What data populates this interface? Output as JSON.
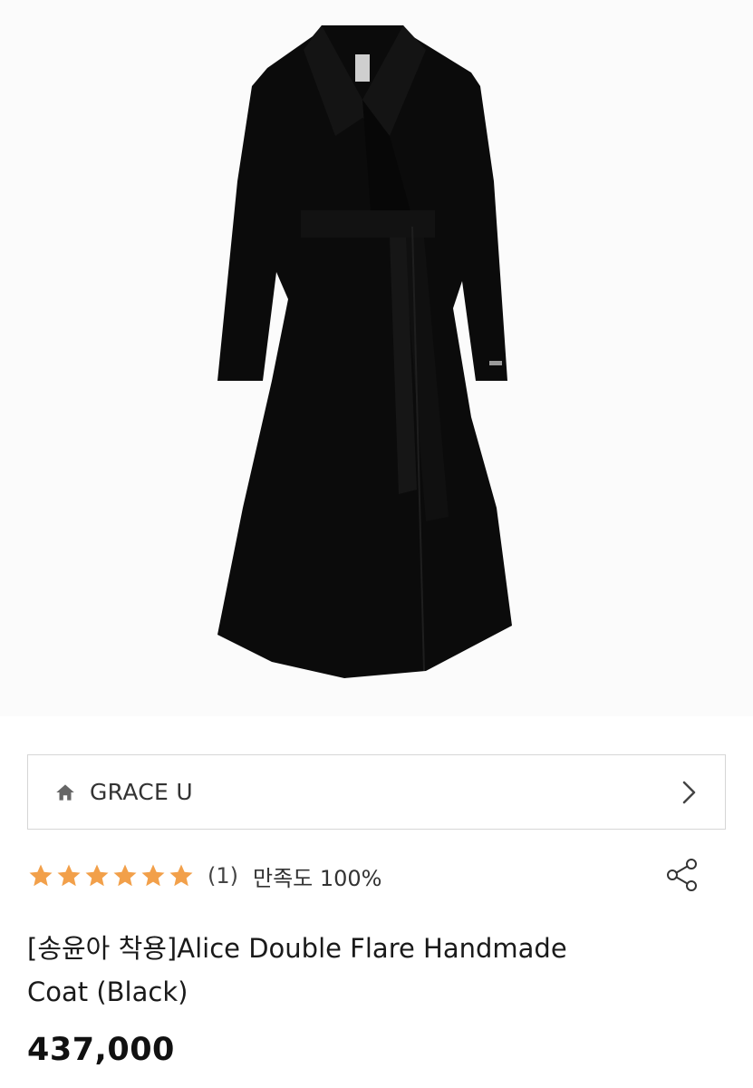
{
  "product": {
    "image_alt": "Black long double-breasted flare coat with belt",
    "brand": "GRACE U",
    "rating": 5,
    "review_count": "(1)",
    "satisfaction": "만족도 100%",
    "title_line1": "[송윤아 착용]Alice Double Flare Handmade",
    "title_line2": "Coat (Black)",
    "price": "437,000"
  },
  "icons": {
    "home": "home-icon",
    "chevron": "chevron-right-icon",
    "star": "star-icon",
    "share": "share-icon"
  },
  "colors": {
    "star": "#F2A04A",
    "coat": "#0b0b0b"
  }
}
